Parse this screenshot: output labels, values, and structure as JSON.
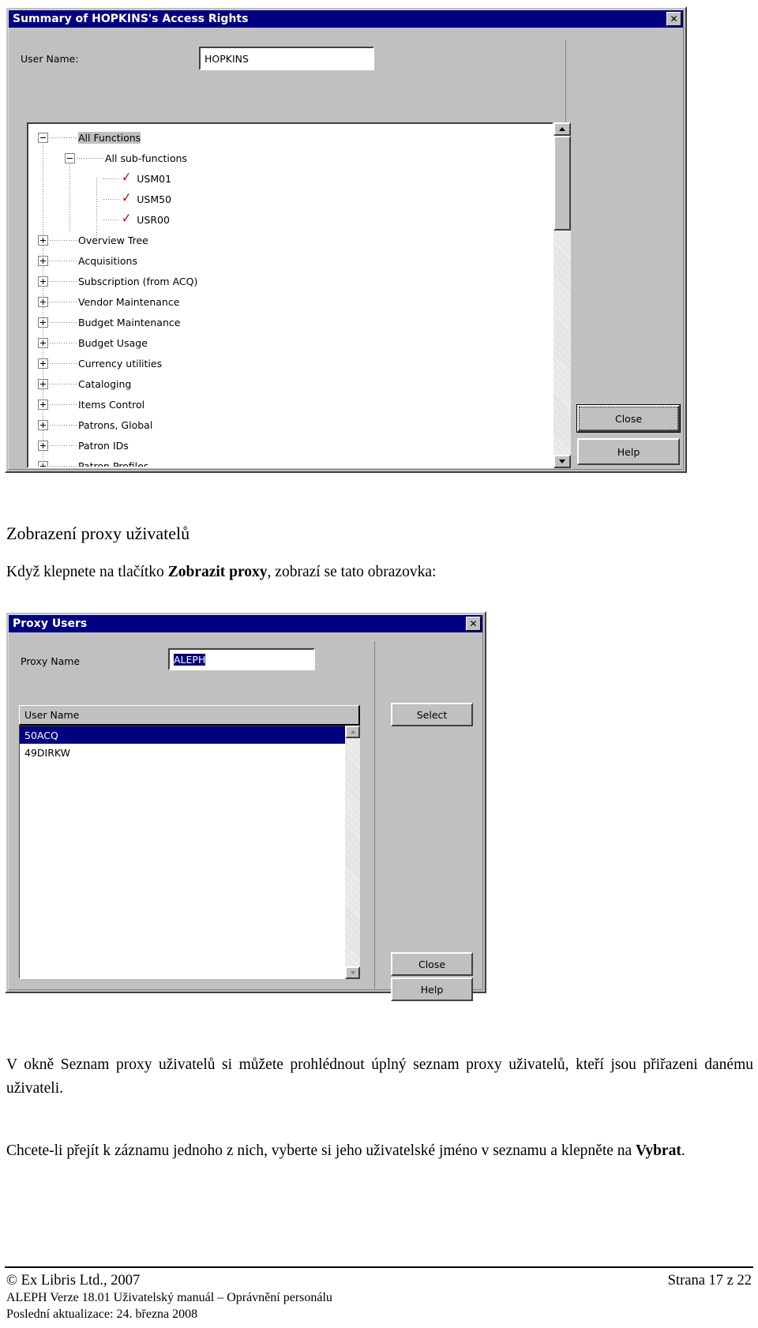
{
  "dialog1": {
    "title": "Summary of HOPKINS's Access Rights",
    "close_icon": "✕",
    "user_name_label": "User Name:",
    "user_name_value": "HOPKINS",
    "tree": [
      {
        "label": "All Functions",
        "level": 0,
        "toggle": "minus",
        "check": false,
        "selected": true
      },
      {
        "label": "All sub-functions",
        "level": 1,
        "toggle": "minus",
        "check": false,
        "selected": false
      },
      {
        "label": "USM01",
        "level": 2,
        "toggle": "none",
        "check": true,
        "selected": false
      },
      {
        "label": "USM50",
        "level": 2,
        "toggle": "none",
        "check": true,
        "selected": false
      },
      {
        "label": "USR00",
        "level": 2,
        "toggle": "none",
        "check": true,
        "selected": false
      },
      {
        "label": "Overview Tree",
        "level": 0,
        "toggle": "plus",
        "check": false,
        "selected": false
      },
      {
        "label": "Acquisitions",
        "level": 0,
        "toggle": "plus",
        "check": false,
        "selected": false
      },
      {
        "label": "Subscription (from ACQ)",
        "level": 0,
        "toggle": "plus",
        "check": false,
        "selected": false
      },
      {
        "label": "Vendor Maintenance",
        "level": 0,
        "toggle": "plus",
        "check": false,
        "selected": false
      },
      {
        "label": "Budget Maintenance",
        "level": 0,
        "toggle": "plus",
        "check": false,
        "selected": false
      },
      {
        "label": "Budget Usage",
        "level": 0,
        "toggle": "plus",
        "check": false,
        "selected": false
      },
      {
        "label": "Currency utilities",
        "level": 0,
        "toggle": "plus",
        "check": false,
        "selected": false
      },
      {
        "label": "Cataloging",
        "level": 0,
        "toggle": "plus",
        "check": false,
        "selected": false
      },
      {
        "label": "Items Control",
        "level": 0,
        "toggle": "plus",
        "check": false,
        "selected": false
      },
      {
        "label": "Patrons, Global",
        "level": 0,
        "toggle": "plus",
        "check": false,
        "selected": false
      },
      {
        "label": "Patron IDs",
        "level": 0,
        "toggle": "plus",
        "check": false,
        "selected": false
      },
      {
        "label": "Patron Profiles",
        "level": 0,
        "toggle": "plus",
        "check": false,
        "selected": false
      }
    ],
    "buttons": {
      "close": "Close",
      "help": "Help"
    }
  },
  "heading": "Zobrazení proxy uživatelů",
  "intro": {
    "before": "Když klepnete na tlačítko ",
    "bold": "Zobrazit proxy",
    "after": ", zobrazí se tato obrazovka:"
  },
  "dialog2": {
    "title": "Proxy Users",
    "close_icon": "✕",
    "proxy_name_label": "Proxy Name",
    "proxy_name_value": "ALEPH",
    "column_header": "User Name",
    "rows": [
      {
        "name": "50ACQ",
        "selected": true
      },
      {
        "name": "49DIRKW",
        "selected": false
      }
    ],
    "buttons": {
      "select": "Select",
      "close": "Close",
      "help": "Help"
    }
  },
  "para1": "V okně Seznam proxy uživatelů si můžete prohlédnout úplný seznam proxy uživatelů, kteří jsou přiřazeni danému uživateli.",
  "para2": {
    "before": "Chcete-li přejít k záznamu jednoho z nich, vyberte si jeho uživatelské jméno v seznamu a klepněte na ",
    "bold": "Vybrat",
    "after": "."
  },
  "footer": {
    "copyright": "© Ex Libris Ltd., 2007",
    "line2": "ALEPH Verze 18.01 Uživatelský manuál – Oprávnění personálu",
    "line3": "Poslední aktualizace: 24. března 2008",
    "page": "Strana 17 z 22"
  },
  "colors": {
    "titlebar": "#000080",
    "face": "#c0c0c0",
    "selection": "#000080",
    "check": "#c00000"
  }
}
